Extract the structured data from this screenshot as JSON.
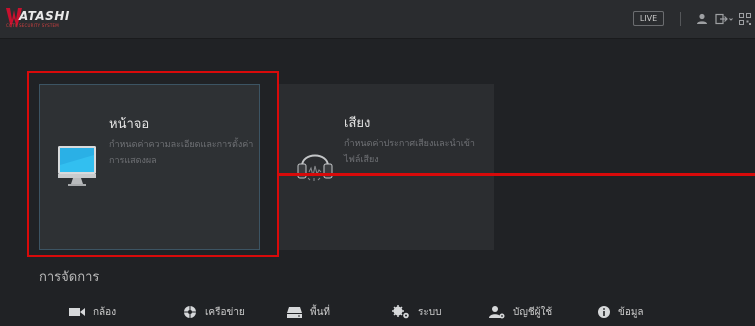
{
  "header": {
    "logo_text": "ATASHI",
    "logo_tagline": "CCTV SECURITY SYSTEM",
    "live_label": "LIVE",
    "icons": [
      "user-icon",
      "logout-icon",
      "qr-menu-icon"
    ]
  },
  "cards": [
    {
      "title": "หน้าจอ",
      "description": "กำหนดค่าความละเอียดและการตั้งค่าการแสดงผล",
      "icon": "monitor-icon"
    },
    {
      "title": "เสียง",
      "description": "กำหนดค่าประกาศเสียงและนำเข้าไฟล์เสียง",
      "icon": "headphones-icon"
    }
  ],
  "management": {
    "title": "การจัดการ",
    "items": [
      {
        "label": "กล้อง",
        "icon": "camera-icon"
      },
      {
        "label": "เครือข่าย",
        "icon": "network-icon"
      },
      {
        "label": "พื้นที่",
        "icon": "storage-icon"
      },
      {
        "label": "ระบบ",
        "icon": "system-gears-icon"
      },
      {
        "label": "บัญชีผู้ใช้",
        "icon": "user-account-icon"
      },
      {
        "label": "ข้อมูล",
        "icon": "info-icon"
      }
    ]
  },
  "colors": {
    "highlight": "#d80a0a",
    "background": "#202225",
    "card": "#2e3134"
  }
}
